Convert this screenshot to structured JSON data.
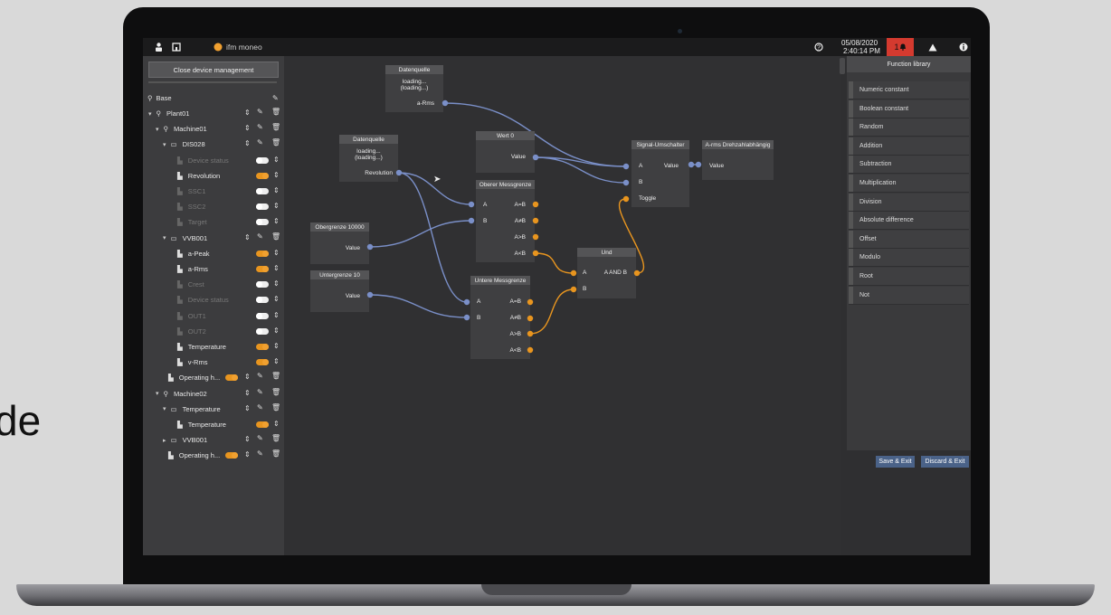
{
  "side_text": "de",
  "topbar": {
    "user_icon": "user-icon",
    "home_icon": "home-icon",
    "app_name": "ifm moneo",
    "date": "05/08/2020",
    "time": "2:40:14 PM",
    "alarm_count": "1"
  },
  "left_panel": {
    "close_button": "Close device management",
    "root": "Base",
    "tree": [
      {
        "label": "Plant01",
        "level": 0
      },
      {
        "label": "Machine01",
        "level": 1
      },
      {
        "label": "DIS028",
        "level": 2
      },
      {
        "label": "Device status",
        "level": 3,
        "dim": true,
        "toggle": "off"
      },
      {
        "label": "Revolution",
        "level": 3,
        "toggle": "on"
      },
      {
        "label": "SSC1",
        "level": 3,
        "dim": true,
        "toggle": "off"
      },
      {
        "label": "SSC2",
        "level": 3,
        "dim": true,
        "toggle": "off"
      },
      {
        "label": "Target",
        "level": 3,
        "dim": true,
        "toggle": "off"
      },
      {
        "label": "VVB001",
        "level": 2
      },
      {
        "label": "a-Peak",
        "level": 3,
        "toggle": "on"
      },
      {
        "label": "a-Rms",
        "level": 3,
        "toggle": "on"
      },
      {
        "label": "Crest",
        "level": 3,
        "dim": true,
        "toggle": "off"
      },
      {
        "label": "Device status",
        "level": 3,
        "dim": true,
        "toggle": "off"
      },
      {
        "label": "OUT1",
        "level": 3,
        "dim": true,
        "toggle": "off"
      },
      {
        "label": "OUT2",
        "level": 3,
        "dim": true,
        "toggle": "off"
      },
      {
        "label": "Temperature",
        "level": 3,
        "toggle": "on"
      },
      {
        "label": "v-Rms",
        "level": 3,
        "toggle": "on"
      },
      {
        "label": "Operating h...",
        "level": 2
      },
      {
        "label": "Machine02",
        "level": 1
      },
      {
        "label": "Temperature",
        "level": 2
      },
      {
        "label": "Temperature",
        "level": 3,
        "toggle": "on"
      },
      {
        "label": "VVB001",
        "level": 2
      },
      {
        "label": "Operating h...",
        "level": 2
      }
    ]
  },
  "nodes": {
    "datenquelle1": {
      "title": "Datenquelle",
      "line1": "loading...",
      "line2": "(loading...)",
      "out": "a-Rms"
    },
    "datenquelle2": {
      "title": "Datenquelle",
      "line1": "loading...",
      "line2": "(loading...)",
      "out": "Revolution"
    },
    "wert0": {
      "title": "Wert 0",
      "out": "Value"
    },
    "obergrenze": {
      "title": "Obergrenze 10000",
      "out": "Value"
    },
    "untergrenze": {
      "title": "Untergrenze 10",
      "out": "Value"
    },
    "oberer": {
      "title": "Oberer Messgrenze",
      "in_a": "A",
      "in_b": "B",
      "o1": "A=B",
      "o2": "A≠B",
      "o3": "A>B",
      "o4": "A<B"
    },
    "unterer": {
      "title": "Untere Messgrenze",
      "in_a": "A",
      "in_b": "B",
      "o1": "A=B",
      "o2": "A≠B",
      "o3": "A>B",
      "o4": "A<B"
    },
    "und": {
      "title": "Und",
      "in_a": "A",
      "in_b": "B",
      "out": "A AND B"
    },
    "signal": {
      "title": "Signal-Umschalter",
      "in_a": "A",
      "in_b": "B",
      "toggle": "Toggle",
      "out": "Value"
    },
    "arms": {
      "title": "A-rms Drehzahlabhängig",
      "in": "Value"
    }
  },
  "function_library": {
    "title": "Function library",
    "items": [
      "Numeric constant",
      "Boolean constant",
      "Random",
      "Addition",
      "Subtraction",
      "Multiplication",
      "Division",
      "Absolute difference",
      "Offset",
      "Modulo",
      "Root",
      "Not"
    ]
  },
  "buttons": {
    "save": "Save & Exit",
    "discard": "Discard & Exit"
  },
  "colors": {
    "accent_orange": "#e8951f",
    "wire_blue": "#7a8fc8",
    "alarm_red": "#d43a2f",
    "button_blue": "#4a6288"
  }
}
